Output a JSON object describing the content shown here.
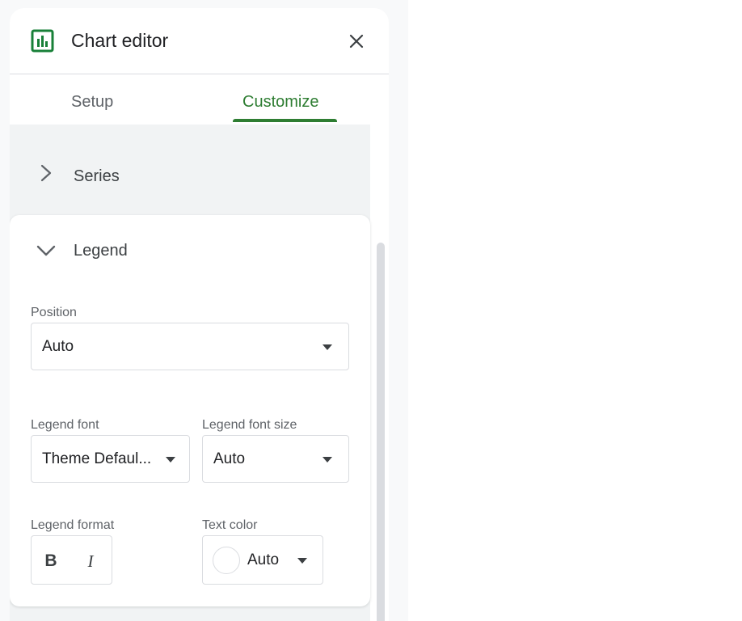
{
  "header": {
    "title": "Chart editor",
    "chart_icon": "chart-icon",
    "close_icon": "close-icon"
  },
  "tabs": [
    {
      "label": "Setup",
      "active": false
    },
    {
      "label": "Customize",
      "active": true
    }
  ],
  "sections": {
    "series": {
      "label": "Series",
      "expanded": false
    },
    "legend": {
      "label": "Legend",
      "expanded": true,
      "position": {
        "label": "Position",
        "value": "Auto"
      },
      "font": {
        "label": "Legend font",
        "value": "Theme Defaul..."
      },
      "font_size": {
        "label": "Legend font size",
        "value": "Auto"
      },
      "format": {
        "label": "Legend format",
        "bold_label": "B",
        "italic_label": "I"
      },
      "text_color": {
        "label": "Text color",
        "value": "Auto",
        "swatch_color": "#ffffff"
      }
    }
  },
  "colors": {
    "accent": "#2e7d32",
    "icon": "#188038",
    "border": "#dadce0"
  }
}
